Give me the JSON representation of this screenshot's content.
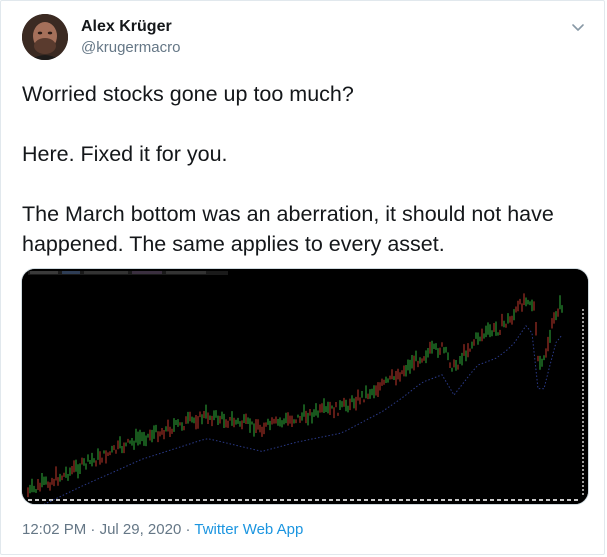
{
  "author": {
    "display_name": "Alex Krüger",
    "handle": "@krugermacro"
  },
  "tweet": {
    "paragraphs": [
      "Worried stocks gone up too much?",
      "Here. Fixed it for you.",
      "The March bottom was an aberration, it should not have happened. The same applies to every asset."
    ]
  },
  "meta": {
    "time": "12:02 PM",
    "separator1": " · ",
    "date": "Jul 29, 2020",
    "separator2": " · ",
    "source_app": "Twitter Web App"
  },
  "icons": {
    "menu": "chevron-down-icon",
    "avatar": "profile-photo"
  },
  "colors": {
    "link": "#1b95e0",
    "secondary_text": "#657786",
    "chart_background": "#000000",
    "candle_up": "#2fae3a",
    "candle_down": "#c0392b"
  }
}
